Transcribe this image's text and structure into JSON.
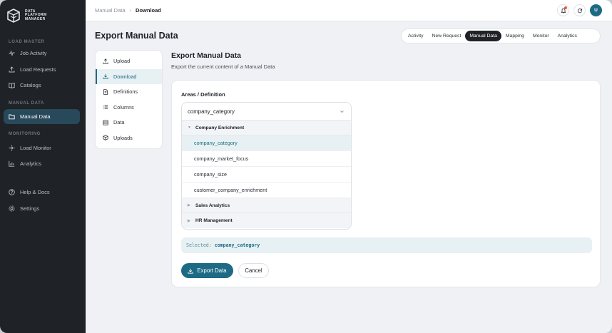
{
  "brand": {
    "line1": "DATA",
    "line2": "PLATFORM",
    "line3": "MANAGER"
  },
  "sidebar": {
    "sections": [
      "LOAD MASTER",
      "MANUAL DATA",
      "MONITORING"
    ],
    "items": [
      {
        "label": "Job Activity",
        "icon": "activity-icon"
      },
      {
        "label": "Load Requests",
        "icon": "upload-icon"
      },
      {
        "label": "Catalogs",
        "icon": "book-icon"
      },
      {
        "label": "Manual Data",
        "icon": "folder-icon"
      },
      {
        "label": "Load Monitor",
        "icon": "monitor-icon"
      },
      {
        "label": "Analytics",
        "icon": "chart-icon"
      },
      {
        "label": "Help & Docs",
        "icon": "help-icon"
      },
      {
        "label": "Settings",
        "icon": "gear-icon"
      }
    ]
  },
  "topbar": {
    "breadcrumb": [
      "Manual Data",
      "Download"
    ],
    "avatar": "U"
  },
  "page": {
    "title": "Export Manual Data"
  },
  "tabs": [
    "Activity",
    "New Request",
    "Manual Data",
    "Mapping",
    "Monitor",
    "Analytics"
  ],
  "submenu": [
    "Upload",
    "Download",
    "Definitions",
    "Columns",
    "Data",
    "Uploads"
  ],
  "content": {
    "title": "Export Manual Data",
    "subtitle": "Export the current content of a Manual Data",
    "field_label": "Areas / Definition",
    "select_value": "company_category",
    "groups": [
      {
        "name": "Company Enrichment",
        "options": [
          "company_category",
          "company_market_focus",
          "company_size",
          "customer_company_enrichment"
        ]
      },
      {
        "name": "Sales Analytics"
      },
      {
        "name": "HR Management"
      }
    ],
    "selected_label": "Selected:",
    "selected_value": "company_category",
    "export_button": "Export Data",
    "cancel_button": "Cancel"
  },
  "colors": {
    "accent": "#1d6a85",
    "sidebar_bg": "#1f2226",
    "active_nav": "#28495a"
  }
}
